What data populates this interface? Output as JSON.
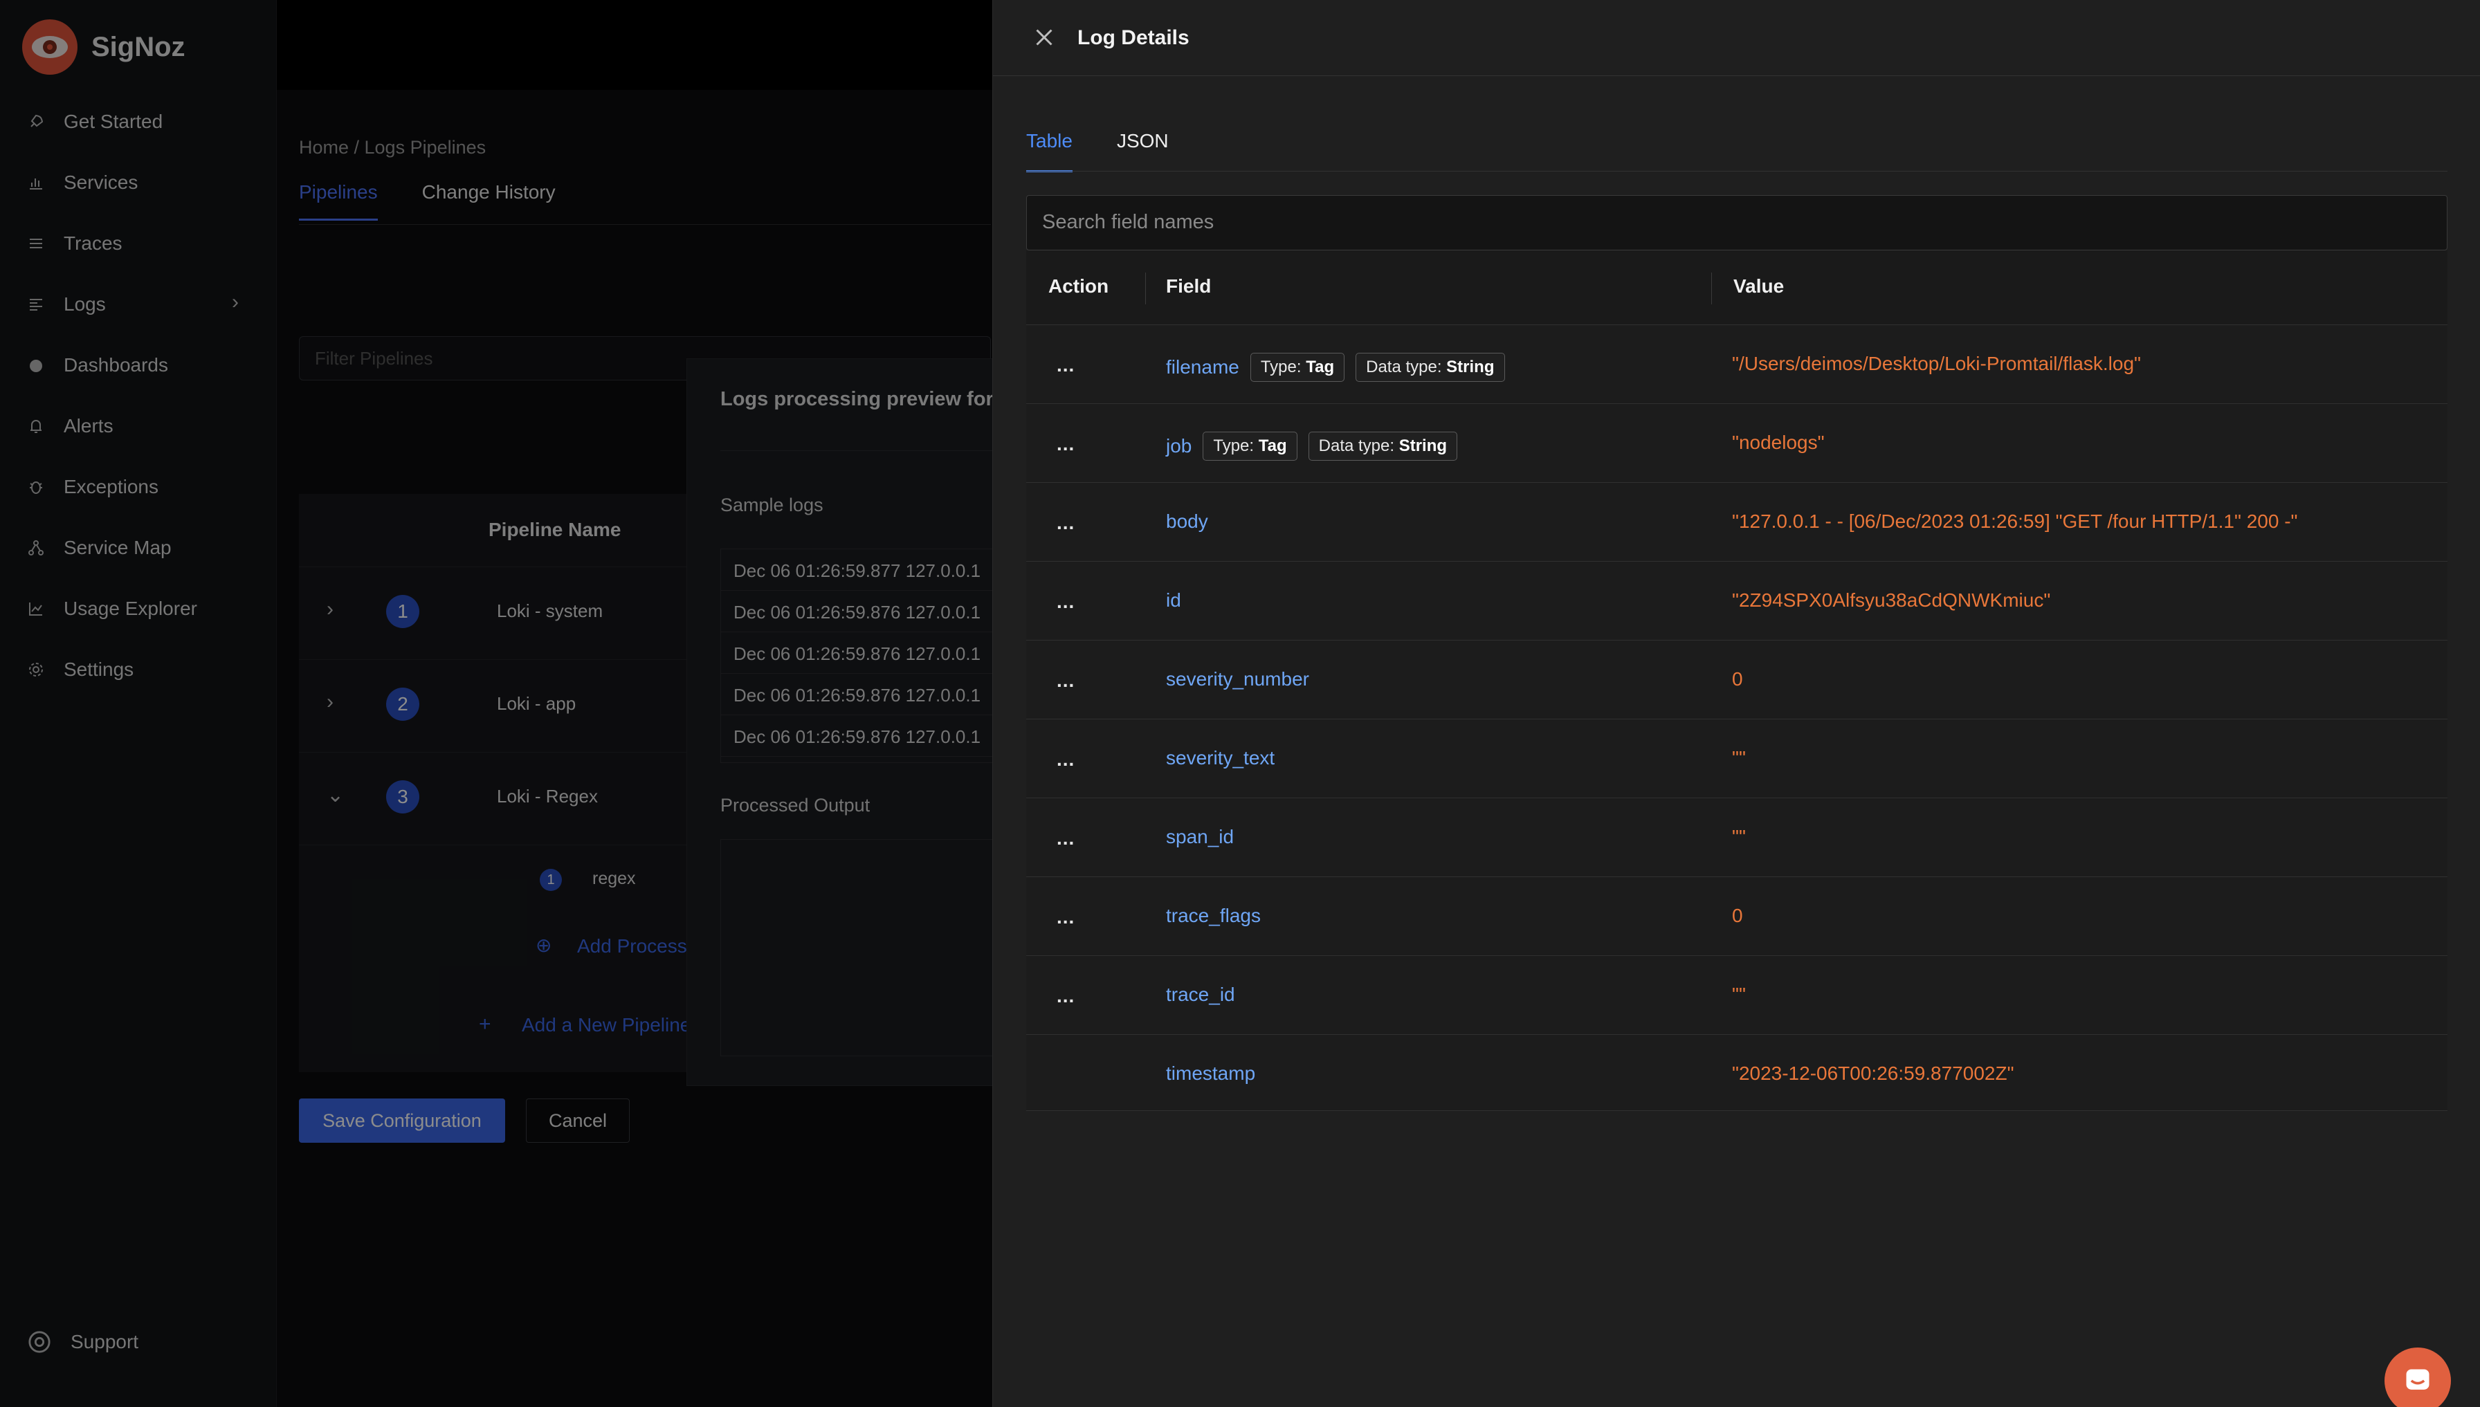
{
  "app": {
    "name": "SigNoz"
  },
  "sidebar": {
    "items": [
      {
        "label": "Get Started",
        "icon": "rocket-icon"
      },
      {
        "label": "Services",
        "icon": "bar-chart-icon"
      },
      {
        "label": "Traces",
        "icon": "list-icon"
      },
      {
        "label": "Logs",
        "icon": "align-left-icon"
      },
      {
        "label": "Dashboards",
        "icon": "dashboard-icon"
      },
      {
        "label": "Alerts",
        "icon": "bell-icon"
      },
      {
        "label": "Exceptions",
        "icon": "bug-icon"
      },
      {
        "label": "Service Map",
        "icon": "network-icon"
      },
      {
        "label": "Usage Explorer",
        "icon": "line-chart-icon"
      },
      {
        "label": "Settings",
        "icon": "gear-icon"
      }
    ],
    "support": "Support"
  },
  "main": {
    "breadcrumb": "Home  /  Logs Pipelines",
    "tabs": [
      "Pipelines",
      "Change History"
    ],
    "filter_placeholder": "Filter Pipelines",
    "table_header": "Pipeline Name",
    "pipelines": [
      {
        "num": "1",
        "name": "Loki - system"
      },
      {
        "num": "2",
        "name": "Loki - app"
      },
      {
        "num": "3",
        "name": "Loki - Regex"
      }
    ],
    "processor": {
      "num": "1",
      "name": "regex"
    },
    "add_processor": "Add Processor",
    "add_pipeline": "Add a New Pipeline",
    "save_label": "Save Configuration",
    "cancel_label": "Cancel"
  },
  "preview": {
    "title": "Logs processing preview for l",
    "sample_label": "Sample logs",
    "samples": [
      "Dec 06 01:26:59.877   127.0.0.1",
      "Dec 06 01:26:59.876   127.0.0.1",
      "Dec 06 01:26:59.876   127.0.0.1",
      "Dec 06 01:26:59.876   127.0.0.1",
      "Dec 06 01:26:59.876   127.0.0.1"
    ],
    "output_label": "Processed Output"
  },
  "drawer": {
    "title": "Log Details",
    "tabs": [
      "Table",
      "JSON"
    ],
    "search_placeholder": "Search field names",
    "columns": [
      "Action",
      "Field",
      "Value"
    ],
    "type_tag_prefix": "Type: ",
    "dtype_prefix": "Data type: ",
    "rows": [
      {
        "action": "...",
        "field": "filename",
        "type": "Tag",
        "dtype": "String",
        "value": "\"/Users/deimos/Desktop/Loki-Promtail/flask.log\""
      },
      {
        "action": "...",
        "field": "job",
        "type": "Tag",
        "dtype": "String",
        "value": "\"nodelogs\""
      },
      {
        "action": "...",
        "field": "body",
        "value": "\"127.0.0.1 - - [06/Dec/2023 01:26:59] \"GET /four HTTP/1.1\" 200 -\""
      },
      {
        "action": "...",
        "field": "id",
        "value": "\"2Z94SPX0Alfsyu38aCdQNWKmiuc\""
      },
      {
        "action": "...",
        "field": "severity_number",
        "value": "0"
      },
      {
        "action": "...",
        "field": "severity_text",
        "value": "\"\""
      },
      {
        "action": "...",
        "field": "span_id",
        "value": "\"\""
      },
      {
        "action": "...",
        "field": "trace_flags",
        "value": "0"
      },
      {
        "action": "...",
        "field": "trace_id",
        "value": "\"\""
      },
      {
        "action": "",
        "field": "timestamp",
        "value": "\"2023-12-06T00:26:59.877002Z\""
      }
    ]
  },
  "colors": {
    "accent": "#4e8cf8",
    "value_orange": "#e9773a",
    "field_blue": "#6fa6f5",
    "brand": "#e0553b"
  }
}
